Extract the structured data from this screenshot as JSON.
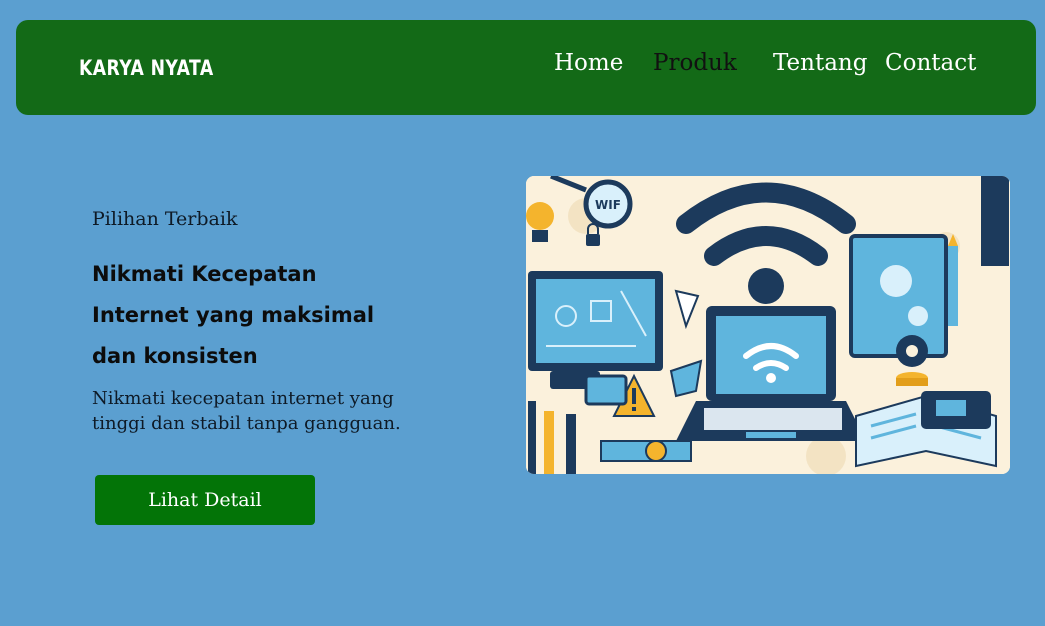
{
  "navbar": {
    "brand": "KARYA NYATA",
    "links": [
      {
        "label": "Home",
        "active": false
      },
      {
        "label": "Produk",
        "active": true
      },
      {
        "label": "Tentang",
        "active": false
      },
      {
        "label": "Contact",
        "active": false
      }
    ]
  },
  "hero": {
    "subtitle": "Pilihan Terbaik",
    "title_lines": [
      "Nikmati Kecepatan",
      "Internet yang maksimal",
      "dan konsisten"
    ],
    "description": "Nikmati kecepatan internet yang tinggi dan stabil tanpa gangguan.",
    "cta_label": "Lihat Detail"
  },
  "illustration": {
    "sign_text": "WIF"
  },
  "colors": {
    "background": "#5b9fd0",
    "navbar": "#136a17",
    "button": "#037407",
    "nav_active": "#111111",
    "nav_text": "#ffffff"
  }
}
